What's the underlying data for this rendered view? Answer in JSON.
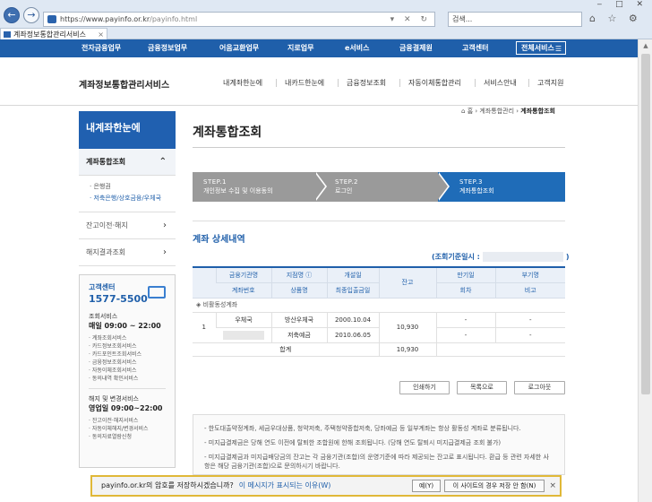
{
  "browser": {
    "url_host": "https://www.payinfo.or.kr",
    "url_path": "/payinfo.html",
    "search_placeholder": "검색...",
    "tab_title": "계좌정보통합관리서비스"
  },
  "gnb": {
    "items": [
      "전자금융업무",
      "금융정보업무",
      "어음교환업무",
      "지로업무",
      "e서비스",
      "금융결제원",
      "고객센터"
    ],
    "all_services": "전체서비스"
  },
  "header": {
    "site_title": "계좌정보통합관리서비스",
    "menu": [
      "내계좌한눈에",
      "내카드한눈에",
      "금융정보조회",
      "자동이체통합관리",
      "서비스안내",
      "고객지원"
    ]
  },
  "breadcrumb": {
    "home": "홈",
    "mid": "계좌통합관리",
    "current": "계좌통합조회"
  },
  "lnb": {
    "title": "내계좌한눈에",
    "active_item": "계좌통합조회",
    "sub_items": [
      "· 은행권",
      "· 저축은행/상호금융/우체국"
    ],
    "items": [
      "잔고이전·해지",
      "해지결과조회"
    ]
  },
  "cs": {
    "label": "고객센터",
    "number": "1577-5500",
    "svc_label": "조회서비스",
    "svc_hours": "매일 09:00 ~ 22:00",
    "svc_list": [
      "· 계좌조회서비스",
      "· 카드정보조회서비스",
      "· 카드포인트조회서비스",
      "· 금융정보조회서비스",
      "· 자동이체조회서비스",
      "· 동의내역 확인서비스"
    ],
    "chg_label": "해지 및 변경서비스",
    "chg_hours": "영업일 09:00~22:00",
    "chg_list": [
      "· 잔고이전·해지서비스",
      "· 자동이체해지/변경서비스",
      "· 동의자료열람신청"
    ]
  },
  "page": {
    "title": "계좌통합조회",
    "steps": [
      {
        "num": "STEP.1",
        "label": "개인정보 수집 및 이용동의"
      },
      {
        "num": "STEP.2",
        "label": "로그인"
      },
      {
        "num": "STEP.3",
        "label": "계좌통합조회"
      }
    ],
    "section_title": "계좌 상세내역",
    "ref_prefix": "(조회기준일시 :",
    "ref_suffix": ")"
  },
  "table": {
    "h1": [
      "금융기관명",
      "지점명 ⓘ",
      "개설일",
      "잔고",
      "만기일",
      "부기명"
    ],
    "h2": [
      "계좌번호",
      "상품명",
      "최종입출금일",
      "회차",
      "비고"
    ],
    "group": "◈ 비활동성계좌",
    "row": {
      "no": "1",
      "bank": "우체국",
      "branch": "방산우체국",
      "open": "2000.10.04",
      "product": "저축예금",
      "last": "2010.06.05",
      "balance": "10,930",
      "maturity": "-",
      "alias": "-",
      "round": "-",
      "note": "-"
    },
    "sum_label": "합계",
    "sum_value": "10,930"
  },
  "buttons": {
    "print": "인쇄하기",
    "list": "목록으로",
    "logout": "로그아웃"
  },
  "notes": [
    "- 한도대출약정계좌, 세금우대상품, 청약저축, 주택청약종합저축, 당좌예금 등 일부계좌는 항상 활동성 계좌로 분류됩니다.",
    "- 미지급결제금은 당해 연도 이전에 탈퇴한 조합원에 한해 조회됩니다. (당해 연도 탈퇴시 미지급결제금 조회 불가)",
    "- 미지급결제금과 미지급배당금의 잔고는 각 금융기관(조합)의 운영기준에 따라 제공되는 잔고로 표시됩니다. 환급 등 관련 자세한 사항은 해당 금융기관(조합)으로 문의하시기 바랍니다."
  ],
  "notification": {
    "message": "payinfo.or.kr의 암호를 저장하시겠습니까?",
    "link": "이 메시지가 표시되는 이유(W)",
    "yes": "예(Y)",
    "never": "이 사이트의 경우 저장 안 함(N)",
    "close": "×"
  }
}
